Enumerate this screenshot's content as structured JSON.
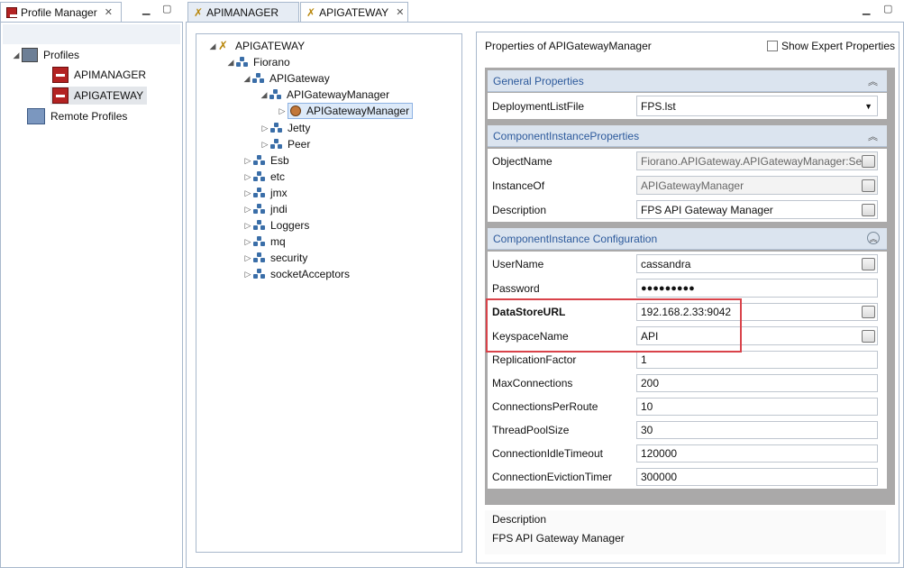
{
  "left_view": {
    "tab_label": "Profile Manager",
    "tree": [
      {
        "label": "Profiles"
      },
      {
        "label": "APIMANAGER"
      },
      {
        "label": "APIGATEWAY"
      },
      {
        "label": "Remote Profiles"
      }
    ]
  },
  "editor_tabs": [
    {
      "label": "APIMANAGER"
    },
    {
      "label": "APIGATEWAY"
    }
  ],
  "config_tree": [
    {
      "label": "APIGATEWAY"
    },
    {
      "label": "Fiorano"
    },
    {
      "label": "APIGateway"
    },
    {
      "label": "APIGatewayManager"
    },
    {
      "label": "APIGatewayManager"
    },
    {
      "label": "Jetty"
    },
    {
      "label": "Peer"
    },
    {
      "label": "Esb"
    },
    {
      "label": "etc"
    },
    {
      "label": "jmx"
    },
    {
      "label": "jndi"
    },
    {
      "label": "Loggers"
    },
    {
      "label": "mq"
    },
    {
      "label": "security"
    },
    {
      "label": "socketAcceptors"
    }
  ],
  "properties": {
    "title": "Properties of APIGatewayManager",
    "show_expert_label": "Show Expert Properties",
    "general": {
      "header": "General Properties",
      "rows": [
        {
          "label": "DeploymentListFile",
          "value": "FPS.lst"
        }
      ]
    },
    "component_instance": {
      "header": "ComponentInstanceProperties",
      "rows": [
        {
          "label": "ObjectName",
          "value": "Fiorano.APIGateway.APIGatewayManager:Serv"
        },
        {
          "label": "InstanceOf",
          "value": "APIGatewayManager"
        },
        {
          "label": "Description",
          "value": "FPS API Gateway Manager"
        }
      ]
    },
    "config": {
      "header": "ComponentInstance Configuration",
      "rows": [
        {
          "label": "UserName",
          "value": "cassandra"
        },
        {
          "label": "Password",
          "value": "●●●●●●●●●"
        },
        {
          "label": "DataStoreURL",
          "value": "192.168.2.33:9042"
        },
        {
          "label": "KeyspaceName",
          "value": "API"
        },
        {
          "label": "ReplicationFactor",
          "value": "1"
        },
        {
          "label": "MaxConnections",
          "value": "200"
        },
        {
          "label": "ConnectionsPerRoute",
          "value": "10"
        },
        {
          "label": "ThreadPoolSize",
          "value": "30"
        },
        {
          "label": "ConnectionIdleTimeout",
          "value": "120000"
        },
        {
          "label": "ConnectionEvictionTimer",
          "value": "300000"
        }
      ]
    },
    "description": {
      "title": "Description",
      "text": "FPS API Gateway Manager"
    }
  },
  "colors": {
    "section_header_text": "#2d5a9c",
    "section_header_bg": "#dbe4ef",
    "highlight_border": "#d9434a"
  }
}
